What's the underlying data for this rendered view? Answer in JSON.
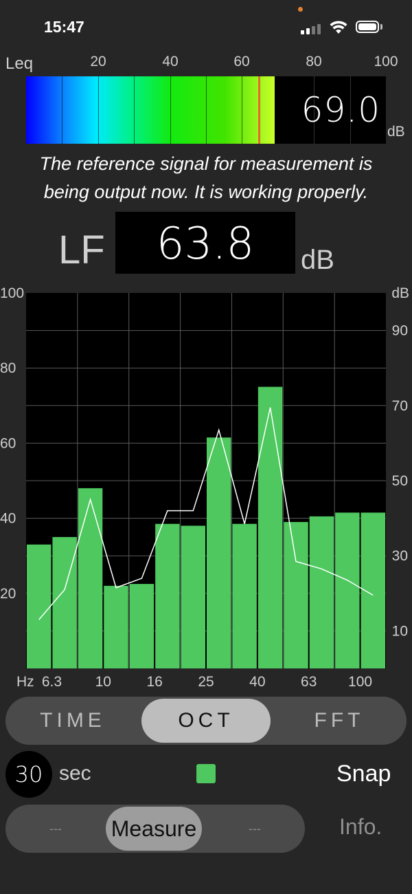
{
  "status_bar": {
    "time": "15:47"
  },
  "leq_meter": {
    "label": "Leq",
    "scale_labels": [
      "20",
      "40",
      "60",
      "80",
      "100"
    ],
    "level": 69.0,
    "peak": 64.5,
    "value": "69.0",
    "unit": "dB"
  },
  "message": {
    "line1": "The reference signal for measurement is",
    "line2": "being output now.  It is working properly."
  },
  "lf": {
    "label": "LF",
    "value": "63.8",
    "unit": "dB"
  },
  "chart_data": {
    "type": "bar",
    "left_axis": {
      "ticks": [
        "100",
        "80",
        "60",
        "40",
        "20"
      ],
      "range": [
        0,
        100
      ]
    },
    "right_axis": {
      "unit": "dB",
      "ticks": [
        "90",
        "70",
        "50",
        "30",
        "10"
      ],
      "range": [
        0,
        100
      ]
    },
    "x_unit": "Hz",
    "x_tick_labels": [
      "6.3",
      "10",
      "16",
      "25",
      "40",
      "63",
      "100"
    ],
    "bars": [
      33,
      35,
      48,
      22,
      22.5,
      38.5,
      38,
      61.5,
      38.5,
      75,
      39,
      40.5,
      41.5,
      41.5
    ],
    "line": [
      13,
      21,
      45,
      21.5,
      24,
      42,
      42,
      63.5,
      38.5,
      69.5,
      28.5,
      26.5,
      23.5,
      19.5
    ],
    "colors": {
      "bar": "#4ec85f",
      "line": "#ffffff",
      "background": "#000000"
    },
    "grid": true
  },
  "mode_tabs": {
    "items": [
      "TIME",
      "OCT",
      "FFT"
    ],
    "selected": "OCT"
  },
  "duration": {
    "value": "30",
    "unit": "sec"
  },
  "snap_label": "Snap",
  "action_tabs": {
    "left": "---",
    "center": "Measure",
    "right": "---"
  },
  "info_label": "Info."
}
